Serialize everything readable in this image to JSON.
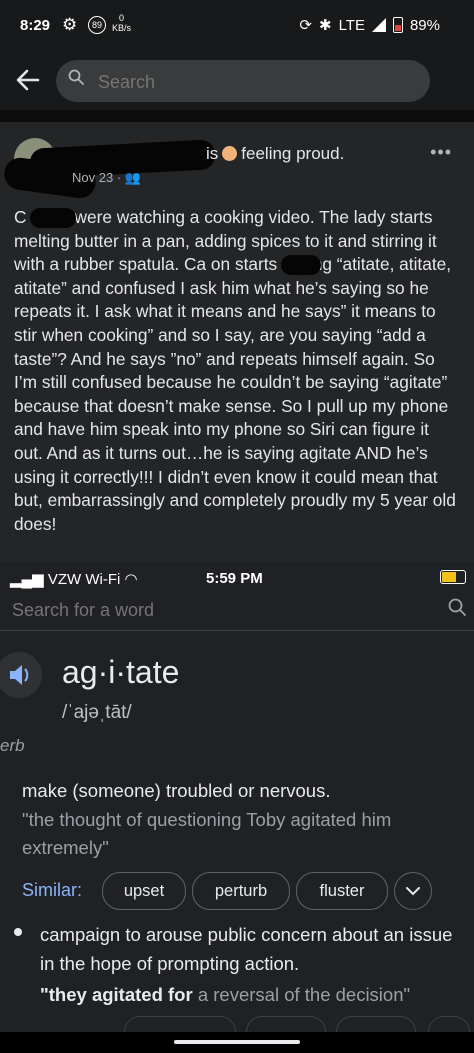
{
  "status_bar": {
    "time": "8:29",
    "notif_count": "89",
    "speed_value": "0",
    "speed_unit": "KB/s",
    "network": "LTE",
    "battery": "89%"
  },
  "search": {
    "placeholder": "Search"
  },
  "post": {
    "feeling": "is 🧑 feeling proud.",
    "feeling_text": "feeling proud.",
    "date": "Nov 23 ·",
    "more": "•••",
    "text": "C        and I were watching a cooking video. The lady starts melting butter in a pan, adding spices to it and stirring it with a rubber spatula. Ca       on starts saying “atitate, atitate, atitate” and confused I ask him what he’s saying so he repeats it. I ask what it means and he says” it means to stir when cooking” and so I say, are you saying “add a taste”? And he says ”no” and repeats himself again. So I’m still confused because he couldn’t be saying “agitate” because that doesn’t make sense. So I pull up my phone and have him speak into my phone so Siri can figure it out. And as it turns out…he is saying agitate AND he’s using it correctly!!! I didn’t even know it could mean that but, embarrassingly and completely proudly my 5 year old does!"
  },
  "embedded": {
    "carrier": "VZW Wi-Fi",
    "time": "5:59 PM",
    "search_placeholder": "Search for a word",
    "word": "ag·i·tate",
    "phonetic": "/ˈajəˌtāt/",
    "part_of_speech": "verb",
    "part_of_speech_visible": "erb",
    "definition1": "make (someone) troubled or nervous.",
    "example1": "\"the thought of questioning Toby agitated him extremely\"",
    "similar_label": "Similar:",
    "similar": [
      "upset",
      "perturb",
      "fluster"
    ],
    "definition2": "campaign to arouse public concern about an issue in the hope of prompting action.",
    "example2_bold": "\"they agitated for",
    "example2_rest": " a reversal of the decision\""
  },
  "colors": {
    "background": "#18191a",
    "card": "#242526",
    "link_blue": "#8ab4f8",
    "battery_low_red": "#e0463d",
    "charging_yellow": "#f2c21b"
  }
}
